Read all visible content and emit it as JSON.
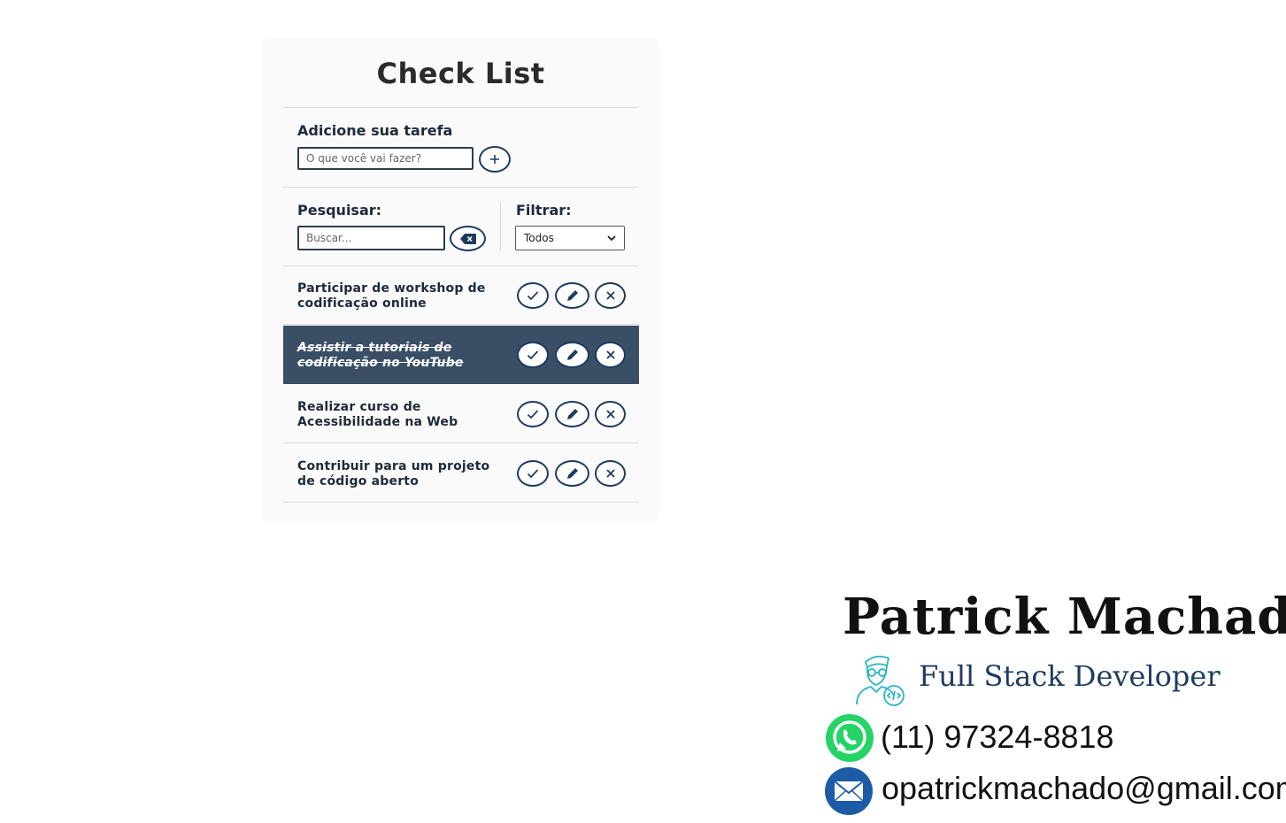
{
  "app": {
    "title": "Check List"
  },
  "add": {
    "label": "Adicione sua tarefa",
    "placeholder": "O que você vai fazer?",
    "button_label": "+"
  },
  "search": {
    "label": "Pesquisar:",
    "placeholder": "Buscar..."
  },
  "filter": {
    "label": "Filtrar:",
    "selected": "Todos"
  },
  "todos": [
    {
      "text": "Participar de workshop de codificação online",
      "done": false
    },
    {
      "text": "Assistir a tutoriais de codificação no YouTube",
      "done": true
    },
    {
      "text": "Realizar curso de Acessibilidade na Web",
      "done": false
    },
    {
      "text": "Contribuir para um projeto de código aberto",
      "done": false
    }
  ],
  "profile": {
    "name": "Patrick Machado",
    "role": "Full Stack Developer",
    "phone": "(11) 97324-8818",
    "email": "opatrickmachado@gmail.com"
  },
  "colors": {
    "accent": "#1f3a5f",
    "done_bg": "#3a4f66",
    "whatsapp": "#25d366",
    "mail": "#1d5ba6"
  },
  "icons": [
    "plus-icon",
    "backspace-icon",
    "check-icon",
    "pencil-icon",
    "close-icon",
    "developer-icon",
    "whatsapp-icon",
    "mail-icon"
  ]
}
